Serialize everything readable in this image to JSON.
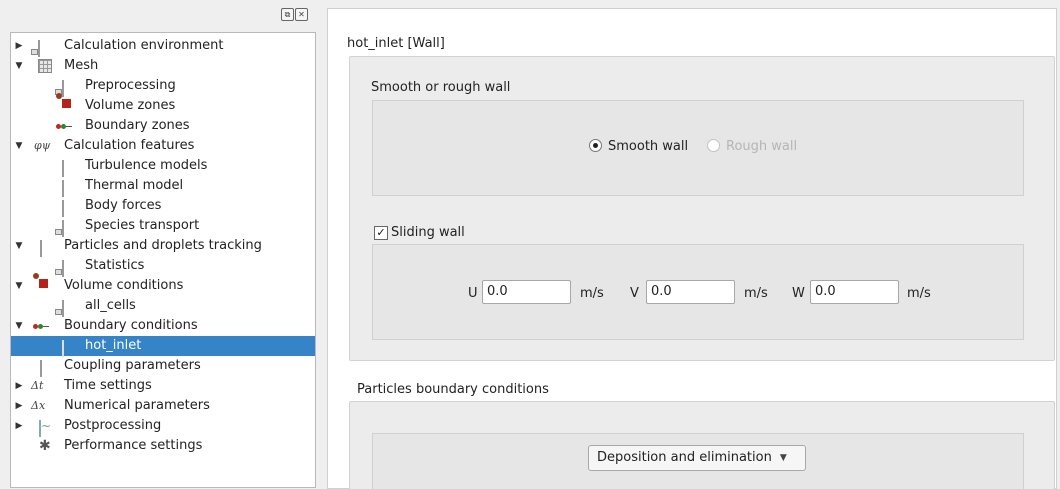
{
  "tree": {
    "items": [
      {
        "label": "Calculation environment"
      },
      {
        "label": "Mesh"
      },
      {
        "label": "Preprocessing"
      },
      {
        "label": "Volume zones"
      },
      {
        "label": "Boundary zones"
      },
      {
        "label": "Calculation features"
      },
      {
        "label": "Turbulence models"
      },
      {
        "label": "Thermal model"
      },
      {
        "label": "Body forces"
      },
      {
        "label": "Species transport"
      },
      {
        "label": "Particles and droplets tracking"
      },
      {
        "label": "Statistics"
      },
      {
        "label": "Volume conditions"
      },
      {
        "label": "all_cells"
      },
      {
        "label": "Boundary conditions"
      },
      {
        "label": "hot_inlet"
      },
      {
        "label": "Coupling parameters"
      },
      {
        "label": "Time settings"
      },
      {
        "label": "Numerical parameters"
      },
      {
        "label": "Postprocessing"
      },
      {
        "label": "Performance settings"
      }
    ],
    "calc_features_symbol": "φψ",
    "time_symbol": "Δt",
    "numerical_symbol": "Δx"
  },
  "panel": {
    "title": "hot_inlet [Wall]",
    "wall_group": {
      "label": "Smooth or rough wall",
      "smooth_label": "Smooth wall",
      "rough_label": "Rough wall",
      "selected": "Smooth wall"
    },
    "sliding": {
      "label": "Sliding wall",
      "checked": true,
      "check_mark": "✓",
      "u_label": "U",
      "u_value": "0.0",
      "v_label": "V",
      "v_value": "0.0",
      "w_label": "W",
      "w_value": "0.0",
      "unit": "m/s"
    },
    "particles": {
      "label": "Particles boundary conditions",
      "combo_value": "Deposition and elimination"
    }
  },
  "colors": {
    "selection": "#3584c8"
  }
}
